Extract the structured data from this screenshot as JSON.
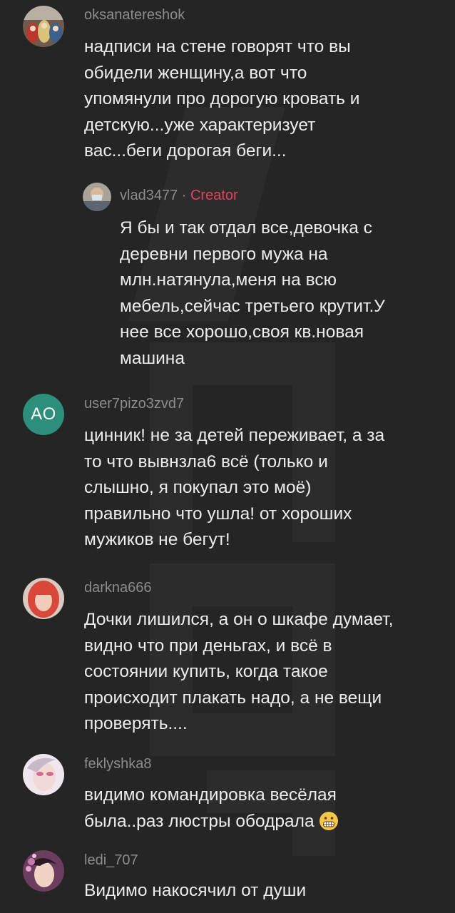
{
  "comments": [
    {
      "username": "oksanatereshok",
      "text": [
        "надписи на стене говорят что вы",
        "обидели женщину,а вот что",
        "упомянули про дорогую кровать и",
        "детскую...уже характеризует",
        "вас...беги дорогая беги..."
      ],
      "avatar": "matryoshka-photo"
    },
    {
      "username": "vlad3477",
      "separator": "·",
      "badge": "Creator",
      "text": [
        "Я бы и так отдал все,девочка с",
        "деревни первого мужа на",
        "млн.натянула,меня на всю",
        "мебель,сейчас третьего крутит.У",
        "нее все хорошо,своя кв.новая",
        "машина"
      ],
      "avatar": "man-with-mask-photo"
    },
    {
      "username": "user7pizo3zvd7",
      "initials": "AO",
      "text": [
        "цинник! не за детей переживает, а за",
        "то что вывнзла6 всё (только и",
        "слышно, я покупал это моё)",
        "правильно что ушла! от хороших",
        "мужиков не бегут!"
      ],
      "avatar_color": "#2d8f7b"
    },
    {
      "username": "darkna666",
      "text": [
        "Дочки лишился, а он о шкафе думает,",
        "видно что при деньгах, и всё в",
        "состоянии купить, когда такое",
        "происходит плакать надо, а не вещи",
        "проверять...."
      ],
      "avatar": "red-hair-woman-photo"
    },
    {
      "username": "feklyshka8",
      "text": [
        "видимо командировка весёлая",
        "была..раз люстры ободрала"
      ],
      "emoji": "grimacing-face-icon",
      "avatar": "woman-pink-makeup-photo"
    },
    {
      "username": "ledi_707",
      "text": [
        "Видимо накосячил от души"
      ],
      "avatar": "woman-floral-photo"
    }
  ],
  "colors": {
    "background": "#252525",
    "username": "#8c8c8c",
    "comment_text": "#ececec",
    "creator_badge": "#e2445c"
  }
}
